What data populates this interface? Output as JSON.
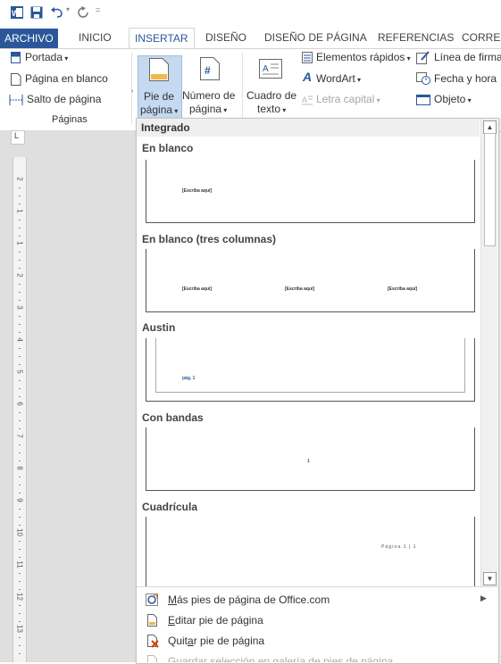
{
  "tabs": {
    "file": "ARCHIVO",
    "home": "INICIO",
    "insert": "INSERTAR",
    "design": "DISEÑO",
    "page_layout": "DISEÑO DE PÁGINA",
    "references": "REFERENCIAS",
    "mailings": "CORRESP"
  },
  "ribbon": {
    "pages": {
      "cover": "Portada",
      "blank_page": "Página en blanco",
      "page_break": "Salto de página",
      "group_label": "Páginas"
    },
    "header_footer": {
      "footer_line1": "Pie de",
      "footer_line2": "página",
      "page_number_line1": "Número de",
      "page_number_line2": "página"
    },
    "text": {
      "text_box_line1": "Cuadro de",
      "text_box_line2": "texto",
      "quick_parts": "Elementos rápidos",
      "wordart": "WordArt",
      "drop_cap": "Letra capital",
      "signature_line": "Línea de firma",
      "date_time": "Fecha y hora",
      "object": "Objeto"
    }
  },
  "gallery": {
    "header": "Integrado",
    "items": [
      {
        "title": "En blanco",
        "placeholders": [
          "[Escriba aquí]"
        ]
      },
      {
        "title": "En blanco (tres columnas)",
        "placeholders": [
          "[Escriba aquí]",
          "[Escriba aquí]",
          "[Escriba aquí]"
        ]
      },
      {
        "title": "Austin",
        "placeholders": [
          "pág. 1"
        ]
      },
      {
        "title": "Con bandas",
        "placeholders": [
          "1"
        ]
      },
      {
        "title": "Cuadrícula",
        "placeholders": [
          "Página 1 | 1"
        ]
      }
    ]
  },
  "menu": {
    "more_footers": "Más pies de página de Office.com",
    "edit_footer": "Editar pie de página",
    "remove_footer": "Quitar pie de página",
    "save_selection": "Guardar selección en galería de pies de página"
  },
  "ruler": [
    "2",
    "1",
    "1",
    "2",
    "3",
    "4",
    "5",
    "6",
    "7",
    "8",
    "9",
    "10",
    "11",
    "12",
    "13"
  ],
  "colors": {
    "accent": "#2b579a",
    "remove_icon": "#d83b01"
  }
}
